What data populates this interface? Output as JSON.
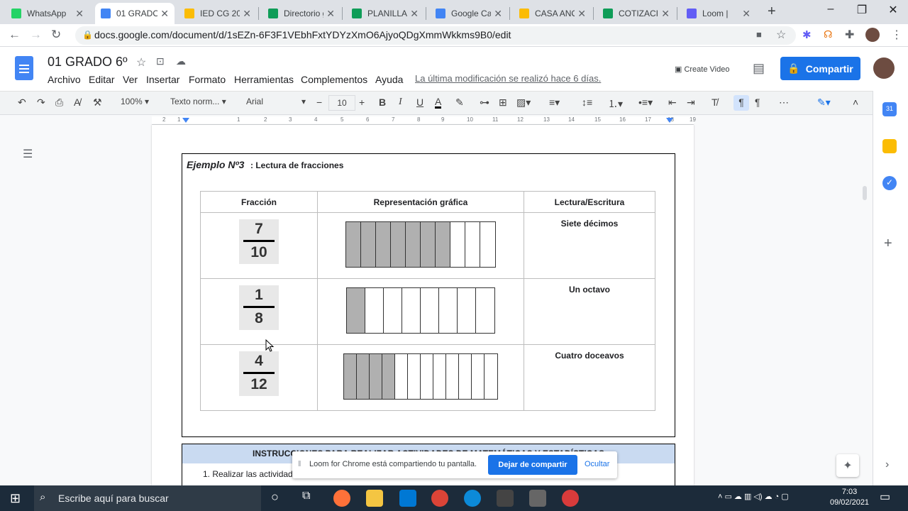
{
  "tabs": [
    {
      "label": "WhatsApp",
      "color": "#25d366"
    },
    {
      "label": "01 GRADO",
      "color": "#4285f4"
    },
    {
      "label": "IED CG 202",
      "color": "#fbbc04"
    },
    {
      "label": "Directorio g",
      "color": "#0f9d58"
    },
    {
      "label": "PLANILLAS",
      "color": "#0f9d58"
    },
    {
      "label": "Google Cal",
      "color": "#4285f4"
    },
    {
      "label": "CASA ANO",
      "color": "#fbbc04"
    },
    {
      "label": "COTIZACIO",
      "color": "#0f9d58"
    },
    {
      "label": "Loom |",
      "color": "#625df5"
    }
  ],
  "browser": {
    "url": "docs.google.com/document/d/1sEZn-6F3F1VEbhFxtYDYzXmO6AjyoQDgXmmWkkms9B0/edit"
  },
  "doc": {
    "title": "01 GRADO 6º",
    "menu": [
      "Archivo",
      "Editar",
      "Ver",
      "Insertar",
      "Formato",
      "Herramientas",
      "Complementos",
      "Ayuda"
    ],
    "last_modified": "La última modificación se realizó hace 6 días.",
    "create_video": "Create Video",
    "share": "Compartir"
  },
  "toolbar": {
    "zoom": "100%",
    "style": "Texto norm...",
    "font": "Arial",
    "size": "10"
  },
  "ruler_ticks": [
    "2",
    "1",
    "1",
    "2",
    "3",
    "4",
    "5",
    "6",
    "7",
    "8",
    "9",
    "10",
    "11",
    "12",
    "13",
    "14",
    "15",
    "16",
    "17",
    "18",
    "19"
  ],
  "example": {
    "title": "Ejemplo Nº3",
    "subtitle": ": Lectura de fracciones",
    "headers": [
      "Fracción",
      "Representación gráfica",
      "Lectura/Escritura"
    ],
    "rows": [
      {
        "num": "7",
        "den": "10",
        "filled": 7,
        "parts": 10,
        "reading": "Siete décimos"
      },
      {
        "num": "1",
        "den": "8",
        "filled": 1,
        "parts": 8,
        "reading": "Un octavo"
      },
      {
        "num": "4",
        "den": "12",
        "filled": 4,
        "parts": 12,
        "reading": "Cuatro doceavos"
      }
    ]
  },
  "instructions": {
    "header": "INSTRUCCIONES PARA REALIZAR ACTIVIDADES DE MATEMÁTICAS Y ESTADÍSTICAS",
    "item1": "1.    Realizar las actividades"
  },
  "loom": {
    "message": "Loom for Chrome está compartiendo tu pantalla.",
    "stop": "Dejar de compartir",
    "hide": "Ocultar"
  },
  "taskbar": {
    "search_placeholder": "Escribe aquí para buscar",
    "time": "7:03",
    "date": "09/02/2021"
  }
}
